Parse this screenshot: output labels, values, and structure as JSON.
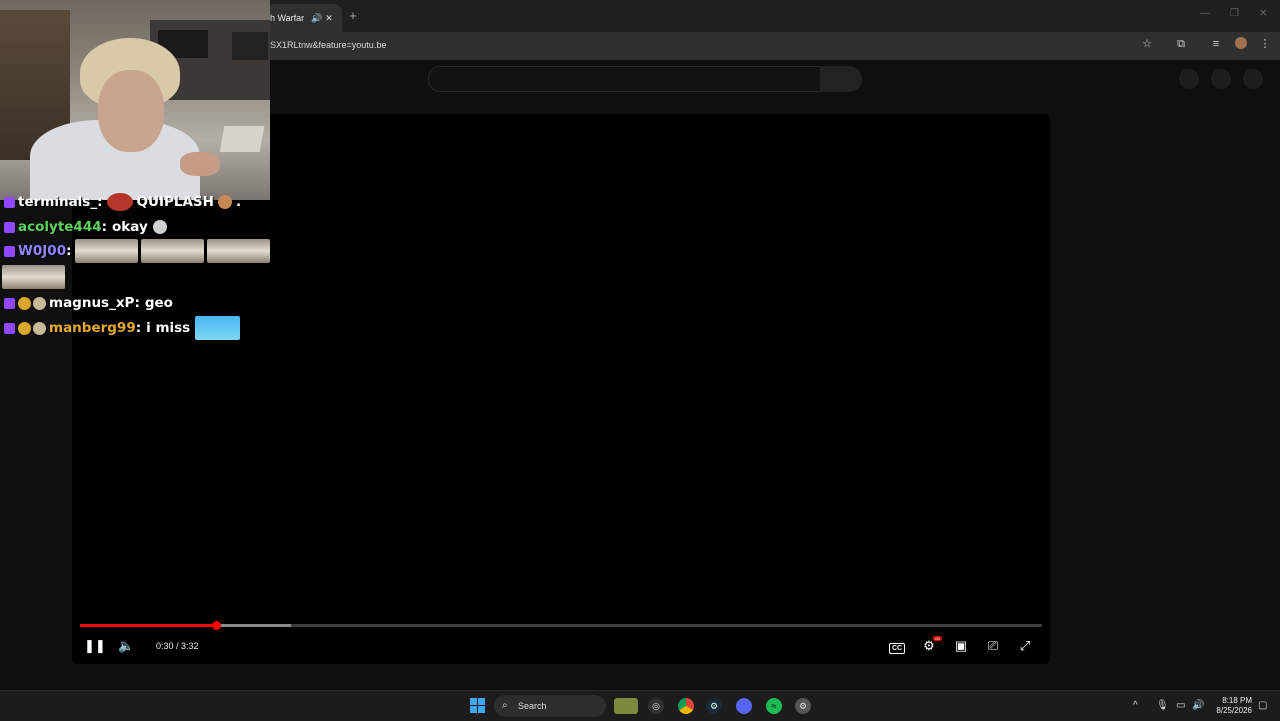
{
  "browser": {
    "tab_title": "h Warfar",
    "tab_audio_icon": "speaker-icon",
    "tab_close_icon": "close-icon",
    "new_tab_icon": "plus-icon",
    "url": "SX1RLtnw&feature=youtu.be",
    "toolbar_icons": [
      "star-icon",
      "extensions-icon",
      "media-icon",
      "profile-avatar",
      "menu-icon"
    ],
    "window_controls": [
      "minimize-icon",
      "restore-icon",
      "close-icon"
    ]
  },
  "player": {
    "current_time": "0:30",
    "separator": " / ",
    "duration": "3:32",
    "played_fraction": 0.1415,
    "buffered_fraction": 0.219,
    "cc_label": "CC",
    "settings_badge": "HD",
    "accent_color": "#ff0000"
  },
  "chat": [
    {
      "user": "terminals_",
      "user_color": "#ffffff",
      "text": "QUIPLASH"
    },
    {
      "user": "acolyte444",
      "user_color": "#5fd35f",
      "text": "okay"
    },
    {
      "user": "W0J00",
      "user_color": "#8f85ff",
      "text": ""
    },
    {
      "user": "magnus_xP",
      "user_color": "#ffffff",
      "text": "geo"
    },
    {
      "user": "manberg99",
      "user_color": "#e6a92e",
      "text": "i miss"
    }
  ],
  "taskbar": {
    "search_label": "Search",
    "time": "8:18 PM",
    "date": "8/25/2026",
    "apps": [
      "files-app-icon",
      "obs-icon",
      "chrome-icon",
      "steam-icon",
      "discord-icon",
      "spotify-icon",
      "settings-icon"
    ]
  }
}
